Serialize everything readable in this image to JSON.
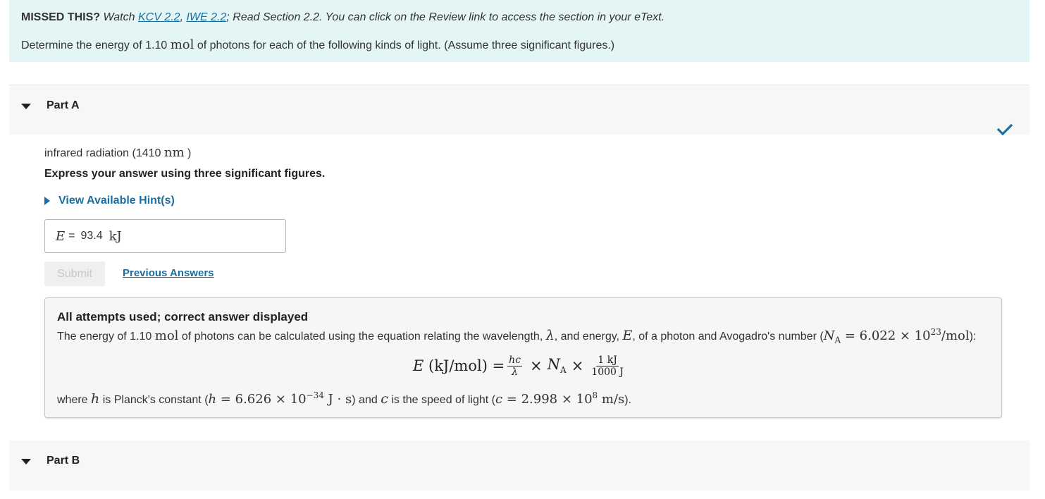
{
  "intro": {
    "missed_label": "MISSED THIS?",
    "watch_text": "Watch",
    "link_kcv": "KCV 2.2",
    "link_iwe": "IWE 2.2",
    "read_text": "; Read Section 2.2. You can click on the Review link to access the section in your eText.",
    "question_pre": "Determine the energy of 1.10",
    "question_unit": "mol",
    "question_post": "of photons for each of the following kinds of light. (Assume three significant figures.)"
  },
  "part_a": {
    "title": "Part A",
    "status": "correct",
    "status_color": "#1a6fa1",
    "prompt_pre": "infrared radiation (1410",
    "prompt_unit": "nm",
    "prompt_post": ")",
    "instruction": "Express your answer using three significant figures.",
    "hint_label": "View Available Hint(s)",
    "answer": {
      "variable": "E",
      "equals": "=",
      "value": "93.4",
      "unit": "kJ"
    },
    "submit_label": "Submit",
    "previous_answers_label": "Previous Answers",
    "feedback": {
      "title": "All attempts used; correct answer displayed",
      "line1_pre": "The energy of 1.10",
      "line1_unit": "mol",
      "line1_mid": "of photons can be calculated using the equation relating the wavelength,",
      "lambda": "λ",
      "line1_mid2": ", and energy,",
      "energy_var": "E",
      "line1_mid3": ", of a photon and Avogadro's number (",
      "na_expr": "NA = 6.022 × 10^23 /mol",
      "line1_end": "):",
      "formula_lhs": "E (kJ/mol) =",
      "formula_frac1_num": "hc",
      "formula_frac1_den": "λ",
      "formula_times": "×",
      "formula_na": "NA",
      "formula_frac2_num": "1 kJ",
      "formula_frac2_den": "1000 J",
      "where_pre": "where",
      "h_var": "h",
      "where_mid": "is Planck's constant (",
      "h_value": "h = 6.626 × 10^−34 J · s",
      "where_mid2": ") and",
      "c_var": "c",
      "where_mid3": "is the speed of light (",
      "c_value": "c = 2.998 × 10^8 m/s",
      "where_end": ")."
    }
  },
  "part_b": {
    "title": "Part B"
  }
}
